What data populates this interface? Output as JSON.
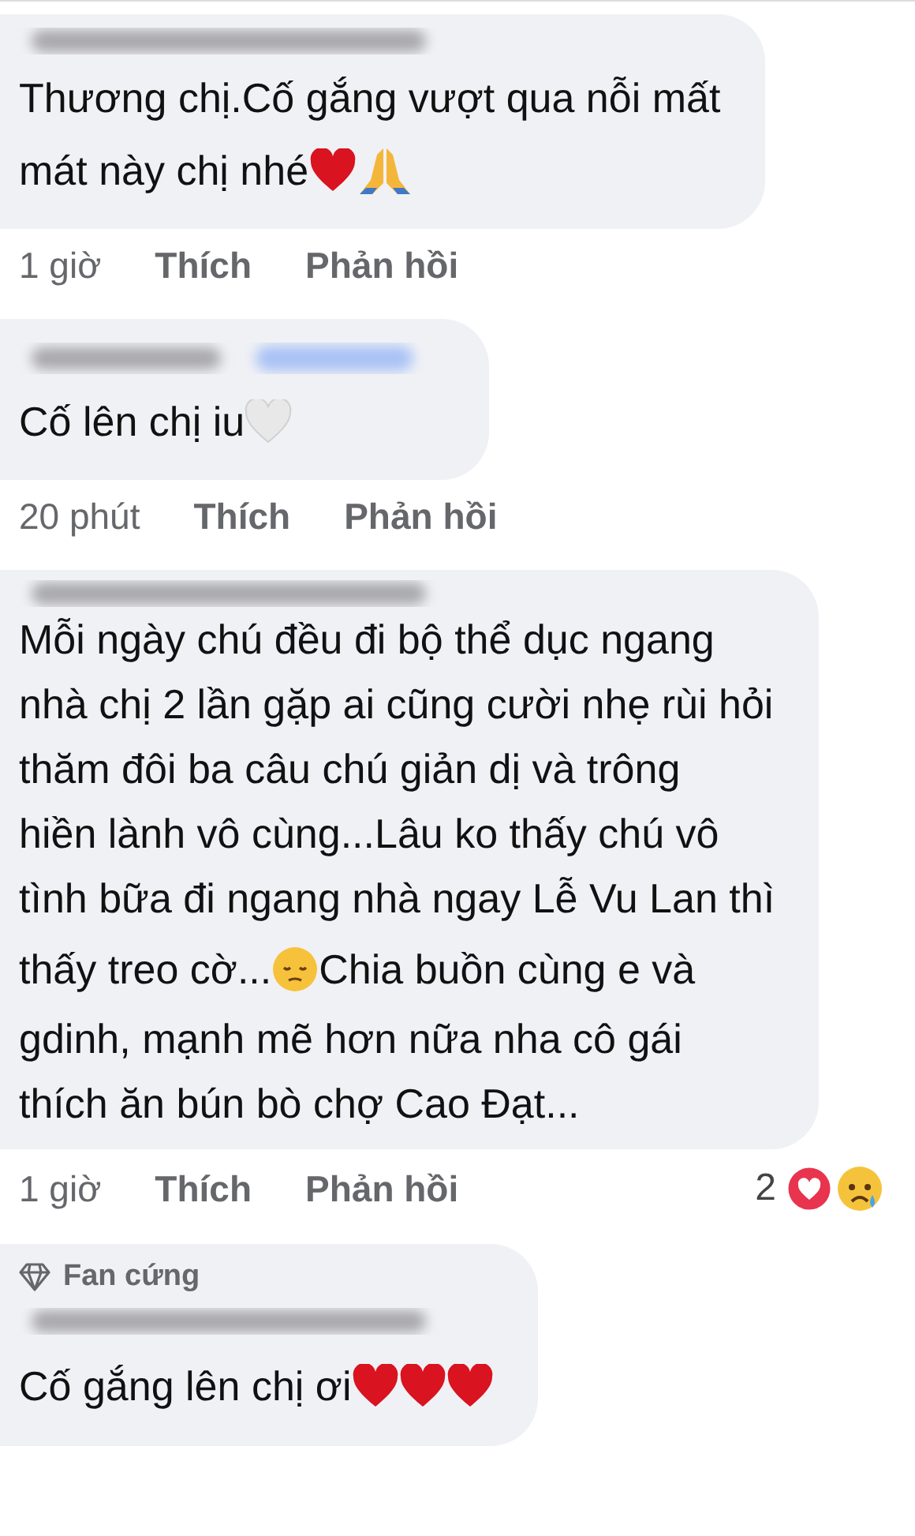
{
  "comments": [
    {
      "name_link": false,
      "lines": [
        [
          {
            "kind": "text",
            "text": "Thương chị.Cố gắng vượt qua nỗi mất"
          }
        ],
        [
          {
            "kind": "text",
            "text": "mát này chị nhé"
          },
          {
            "kind": "heart"
          },
          {
            "kind": "pray"
          }
        ]
      ],
      "time": "1 giờ",
      "like": "Thích",
      "reply": "Phản hồi"
    },
    {
      "name_link": true,
      "lines": [
        [
          {
            "kind": "text",
            "text": "Cố lên chị iu"
          },
          {
            "kind": "whiteheart"
          }
        ]
      ],
      "time": "20 phút",
      "like": "Thích",
      "reply": "Phản hồi"
    },
    {
      "name_link": false,
      "lines": [
        [
          {
            "kind": "text",
            "text": "Mỗi ngày chú đều đi bộ thể dục ngang"
          }
        ],
        [
          {
            "kind": "text",
            "text": "nhà chị 2 lần gặp ai cũng cười nhẹ rùi hỏi"
          }
        ],
        [
          {
            "kind": "text",
            "text": "thăm đôi ba câu chú giản dị và trông"
          }
        ],
        [
          {
            "kind": "text",
            "text": "hiền lành vô cùng...Lâu ko thấy chú vô"
          }
        ],
        [
          {
            "kind": "text",
            "text": "tình bữa đi ngang nhà ngay Lễ Vu Lan thì"
          }
        ],
        [
          {
            "kind": "text",
            "text": "thấy treo cờ... "
          },
          {
            "kind": "pensive"
          },
          {
            "kind": "text",
            "text": "Chia buồn cùng e và"
          }
        ],
        [
          {
            "kind": "text",
            "text": "gdinh, mạnh mẽ hơn nữa nha cô gái"
          }
        ],
        [
          {
            "kind": "text",
            "text": "thích ăn bún bò chợ Cao Đạt..."
          }
        ]
      ],
      "time": "1 giờ",
      "like": "Thích",
      "reply": "Phản hồi",
      "reactions": {
        "count": "2"
      }
    },
    {
      "badge": "Fan cứng",
      "name_link": false,
      "lines": [
        [
          {
            "kind": "text",
            "text": "Cố gắng lên chị ơi "
          },
          {
            "kind": "heart"
          },
          {
            "kind": "heart"
          },
          {
            "kind": "heart"
          }
        ]
      ]
    }
  ]
}
